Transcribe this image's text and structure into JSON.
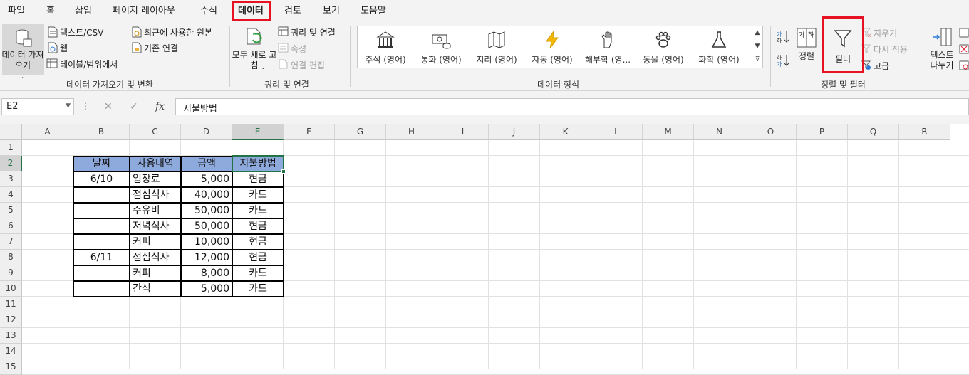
{
  "menu": {
    "tabs": [
      "파일",
      "홈",
      "삽입",
      "페이지 레이아웃",
      "수식",
      "데이터",
      "검토",
      "보기",
      "도움말"
    ],
    "active_tab": "데이터"
  },
  "ribbon": {
    "get_data": {
      "big_button": "데이터 가져오기",
      "items": [
        "텍스트/CSV",
        "웹",
        "테이블/범위에서",
        "최근에 사용한 원본",
        "기존 연결"
      ],
      "group_label": "데이터 가져오기 및 변환"
    },
    "queries": {
      "refresh_all": "모두 새로 고침",
      "items": [
        "쿼리 및 연결",
        "속성",
        "연결 편집"
      ],
      "group_label": "쿼리 및 연결"
    },
    "data_types": {
      "items": [
        "주식 (영어)",
        "통화 (영어)",
        "지리 (영어)",
        "자동 (영어)",
        "해부학 (영...",
        "동물 (영어)",
        "화학 (영어)"
      ],
      "group_label": "데이터 형식"
    },
    "sort_filter": {
      "sort": "정렬",
      "filter": "필터",
      "clear": "지우기",
      "reapply": "다시 적용",
      "advanced": "고급",
      "group_label": "정렬 및 필터"
    },
    "tools": {
      "text_to_columns": "텍스트 나누기"
    }
  },
  "formula_bar": {
    "name_box": "E2",
    "formula": "지불방법"
  },
  "columns": [
    "A",
    "B",
    "C",
    "D",
    "E",
    "F",
    "G",
    "H",
    "I",
    "J",
    "K",
    "L",
    "M",
    "N",
    "O",
    "P",
    "Q",
    "R"
  ],
  "rows": [
    "1",
    "2",
    "3",
    "4",
    "5",
    "6",
    "7",
    "8",
    "9",
    "10",
    "11",
    "12",
    "13",
    "14",
    "15"
  ],
  "table": {
    "headers": [
      "날짜",
      "사용내역",
      "금액",
      "지불방법"
    ],
    "rows": [
      [
        "6/10",
        "입장료",
        "5,000",
        "현금"
      ],
      [
        "",
        "점심식사",
        "40,000",
        "카드"
      ],
      [
        "",
        "주유비",
        "50,000",
        "카드"
      ],
      [
        "",
        "저녁식사",
        "50,000",
        "현금"
      ],
      [
        "",
        "커피",
        "10,000",
        "현금"
      ],
      [
        "6/11",
        "점심식사",
        "12,000",
        "현금"
      ],
      [
        "",
        "커피",
        "8,000",
        "카드"
      ],
      [
        "",
        "간식",
        "5,000",
        "카드"
      ]
    ]
  },
  "colors": {
    "header_fill": "#8ea9db",
    "excel_green": "#217346",
    "highlight_red": "#e81123"
  }
}
